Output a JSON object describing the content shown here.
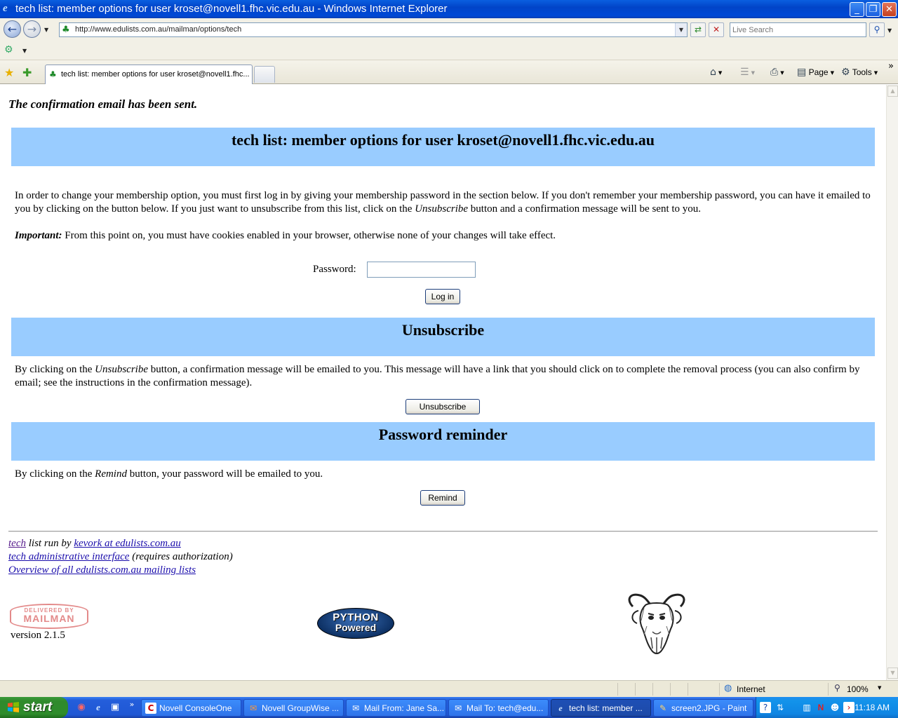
{
  "window": {
    "title": "tech list: member options for user kroset@novell1.fhc.vic.edu.au - Windows Internet Explorer",
    "minimize_glyph": "_",
    "maximize_glyph": "❐",
    "close_glyph": "✕"
  },
  "address_bar": {
    "url": "http://www.edulists.com.au/mailman/options/tech",
    "search_placeholder": "Live Search"
  },
  "tabs": {
    "active_label": "tech list: member options for user kroset@novell1.fhc...",
    "page_menu": "Page",
    "tools_menu": "Tools"
  },
  "page": {
    "confirmation": "The confirmation email has been sent.",
    "header_title": "tech list: member options for user kroset@novell1.fhc.vic.edu.au",
    "intro_part1": "In order to change your membership option, you must first log in by giving your membership password in the section below. If you don't remember your membership password, you can have it emailed to you by clicking on the button below. If you just want to unsubscribe from this list, click on the ",
    "intro_em": "Unsubscribe",
    "intro_part2": " button and a confirmation message will be sent to you.",
    "important_label": "Important:",
    "important_text": " From this point on, you must have cookies enabled in your browser, otherwise none of your changes will take effect.",
    "password_label": "Password:",
    "password_value": "",
    "login_button": "Log in",
    "unsubscribe_heading": "Unsubscribe",
    "unsub_part1": "By clicking on the ",
    "unsub_em": "Unsubscribe",
    "unsub_part2": " button, a confirmation message will be emailed to you. This message will have a link that you should click on to complete the removal process (you can also confirm by email; see the instructions in the confirmation message).",
    "unsubscribe_button": "Unsubscribe",
    "reminder_heading": "Password reminder",
    "remind_part1": "By clicking on the ",
    "remind_em": "Remind",
    "remind_part2": " button, your password will be emailed to you.",
    "remind_button": "Remind"
  },
  "footer": {
    "list_link": "tech",
    "run_by_text": " list run by ",
    "owner_link": "kevork at edulists.com.au",
    "admin_link": "tech administrative interface",
    "admin_note": " (requires authorization)",
    "overview_link": "Overview of all edulists.com.au mailing lists",
    "mailman_small": "DELIVERED BY",
    "mailman_big": "MAILMAN",
    "version": "version 2.1.5",
    "python_line1": "PYTHON",
    "python_line2": "Powered"
  },
  "status_bar": {
    "zone": "Internet",
    "zoom": "100%"
  },
  "taskbar": {
    "start_label": "start",
    "tasks": [
      {
        "label": "Novell ConsoleOne",
        "icon": "C"
      },
      {
        "label": "Novell GroupWise ...",
        "icon": "✉"
      },
      {
        "label": "Mail From: Jane Sa...",
        "icon": "✉"
      },
      {
        "label": "Mail To: tech@edu...",
        "icon": "✉"
      },
      {
        "label": "tech list: member ...",
        "icon": "e"
      },
      {
        "label": "screen2.JPG - Paint",
        "icon": "✎"
      }
    ],
    "clock": "11:18 AM"
  }
}
